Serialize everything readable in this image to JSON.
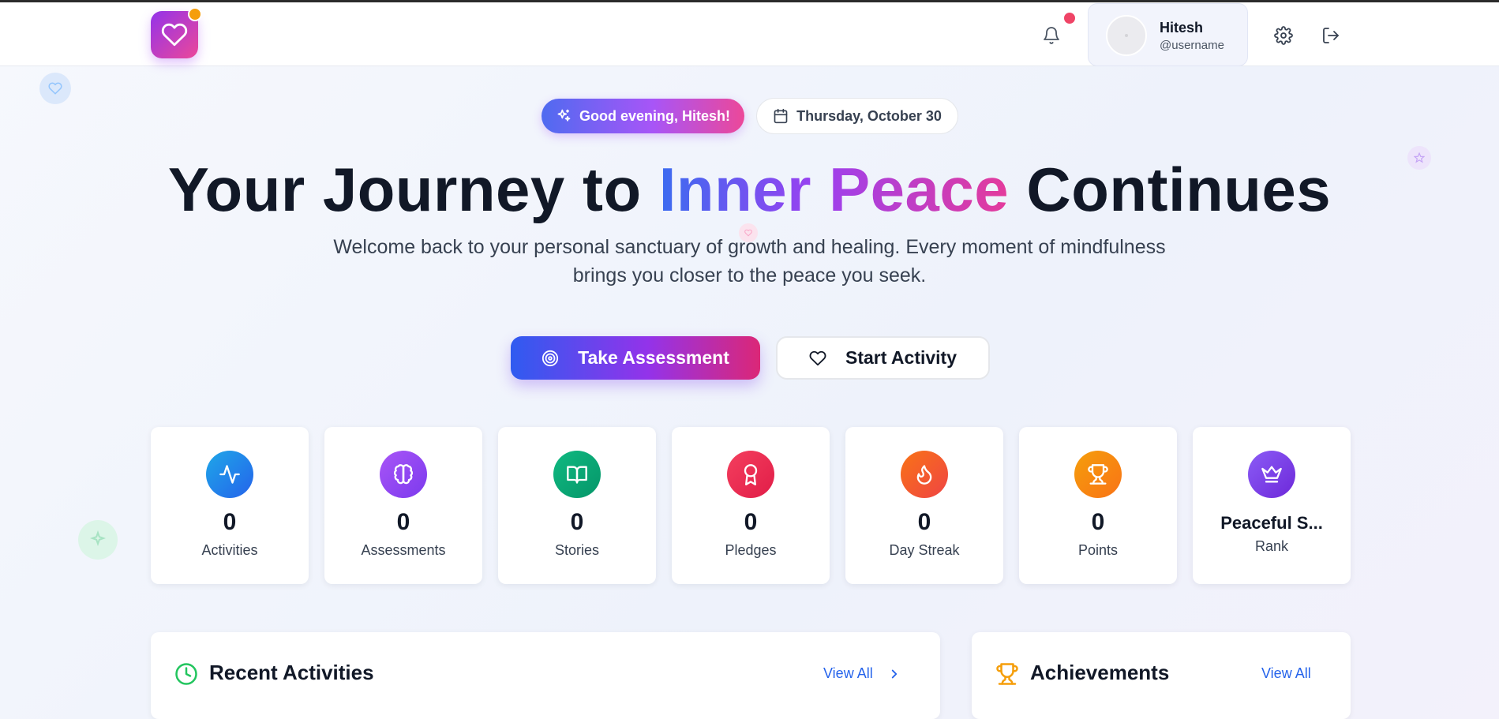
{
  "header": {
    "user_name": "Hitesh",
    "user_handle": "@username"
  },
  "hero": {
    "greeting": "Good evening, Hitesh!",
    "date": "Thursday, October 30",
    "title_part1": "Your Journey to",
    "title_highlight": "Inner Peace",
    "title_part2": "Continues",
    "subtitle": "Welcome back to your personal sanctuary of growth and healing. Every moment of mindfulness brings you closer to the peace you seek.",
    "primary_button": "Take Assessment",
    "secondary_button": "Start Activity"
  },
  "stats": [
    {
      "value": "0",
      "label": "Activities",
      "icon": "activity-icon",
      "color": "#1ea7e8"
    },
    {
      "value": "0",
      "label": "Assessments",
      "icon": "brain-icon",
      "color": "#a855f7"
    },
    {
      "value": "0",
      "label": "Stories",
      "icon": "book-open-icon",
      "color": "#10b981"
    },
    {
      "value": "0",
      "label": "Pledges",
      "icon": "award-icon",
      "color": "#f43f5e"
    },
    {
      "value": "0",
      "label": "Day Streak",
      "icon": "flame-icon",
      "color": "#f97316"
    },
    {
      "value": "0",
      "label": "Points",
      "icon": "trophy-icon",
      "color": "#f59e0b"
    },
    {
      "value": "Peaceful S...",
      "label": "Rank",
      "icon": "crown-icon",
      "color": "#7c3aed"
    }
  ],
  "panels": {
    "recent_title": "Recent Activities",
    "recent_link": "View All",
    "achievements_title": "Achievements",
    "achievements_link": "View All"
  },
  "colors": {
    "accent_blue": "#2f5bf0",
    "accent_purple": "#9333ea",
    "accent_pink": "#db2777",
    "link": "#2563eb"
  }
}
